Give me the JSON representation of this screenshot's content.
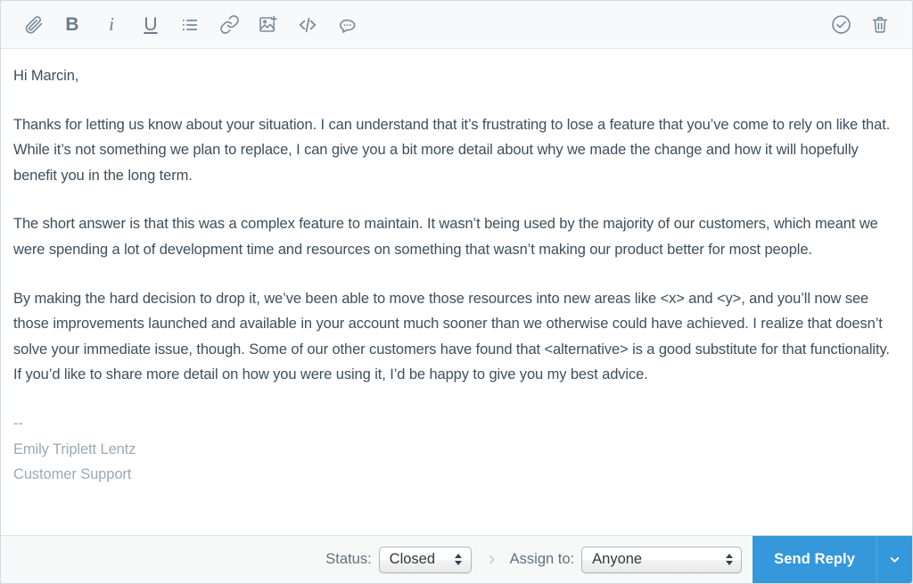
{
  "toolbar": {
    "left_items": [
      {
        "name": "attachment-icon",
        "label": "Attach file"
      },
      {
        "name": "bold-icon",
        "label": "B"
      },
      {
        "name": "italic-icon",
        "label": "i"
      },
      {
        "name": "underline-icon",
        "label": "U"
      },
      {
        "name": "bullet-list-icon",
        "label": "Bulleted list"
      },
      {
        "name": "link-icon",
        "label": "Insert link"
      },
      {
        "name": "insert-image-icon",
        "label": "Insert image"
      },
      {
        "name": "code-icon",
        "label": "Code"
      },
      {
        "name": "saved-reply-icon",
        "label": "Saved replies"
      }
    ],
    "right_items": [
      {
        "name": "check-circle-icon",
        "label": "Mark as done"
      },
      {
        "name": "trash-icon",
        "label": "Delete draft"
      }
    ]
  },
  "message": {
    "greeting": "Hi Marcin,",
    "paragraphs": [
      "Thanks for letting us know about your situation. I can understand that it’s frustrating to lose a feature that you’ve come to rely on like that. While it’s not something we plan to replace, I can give you a bit more detail about why we made the change and how it will hopefully benefit you in the long term.",
      "The short answer is that this was a complex feature to maintain. It wasn’t being used by the majority of our customers, which meant we were spending a lot of development time and resources on something that wasn’t making our product better for most people.",
      "By making the hard decision to drop it, we’ve been able to move those resources into new areas like <x> and <y>, and you’ll now see those improvements launched and available in your account much sooner than we otherwise could have achieved. I realize that doesn’t solve your immediate issue, though. Some of our other customers have found that <alternative> is a good substitute for that functionality. If you’d like to share more detail on how you were using it, I’d be happy to give you my best advice."
    ],
    "signature": {
      "separator": "--",
      "name": "Emily Triplett Lentz",
      "title": "Customer Support"
    }
  },
  "footer": {
    "status_label": "Status:",
    "status_value": "Closed",
    "assign_label": "Assign to:",
    "assign_value": "Anyone",
    "send_label": "Send Reply"
  },
  "colors": {
    "accent_blue": "#3498db",
    "toolbar_bg": "#f8f9fa",
    "footer_bg": "#f7f9f9",
    "body_text": "#3d4f5d",
    "signature_text": "#9aa9b5",
    "icon": "#7b8b99"
  }
}
